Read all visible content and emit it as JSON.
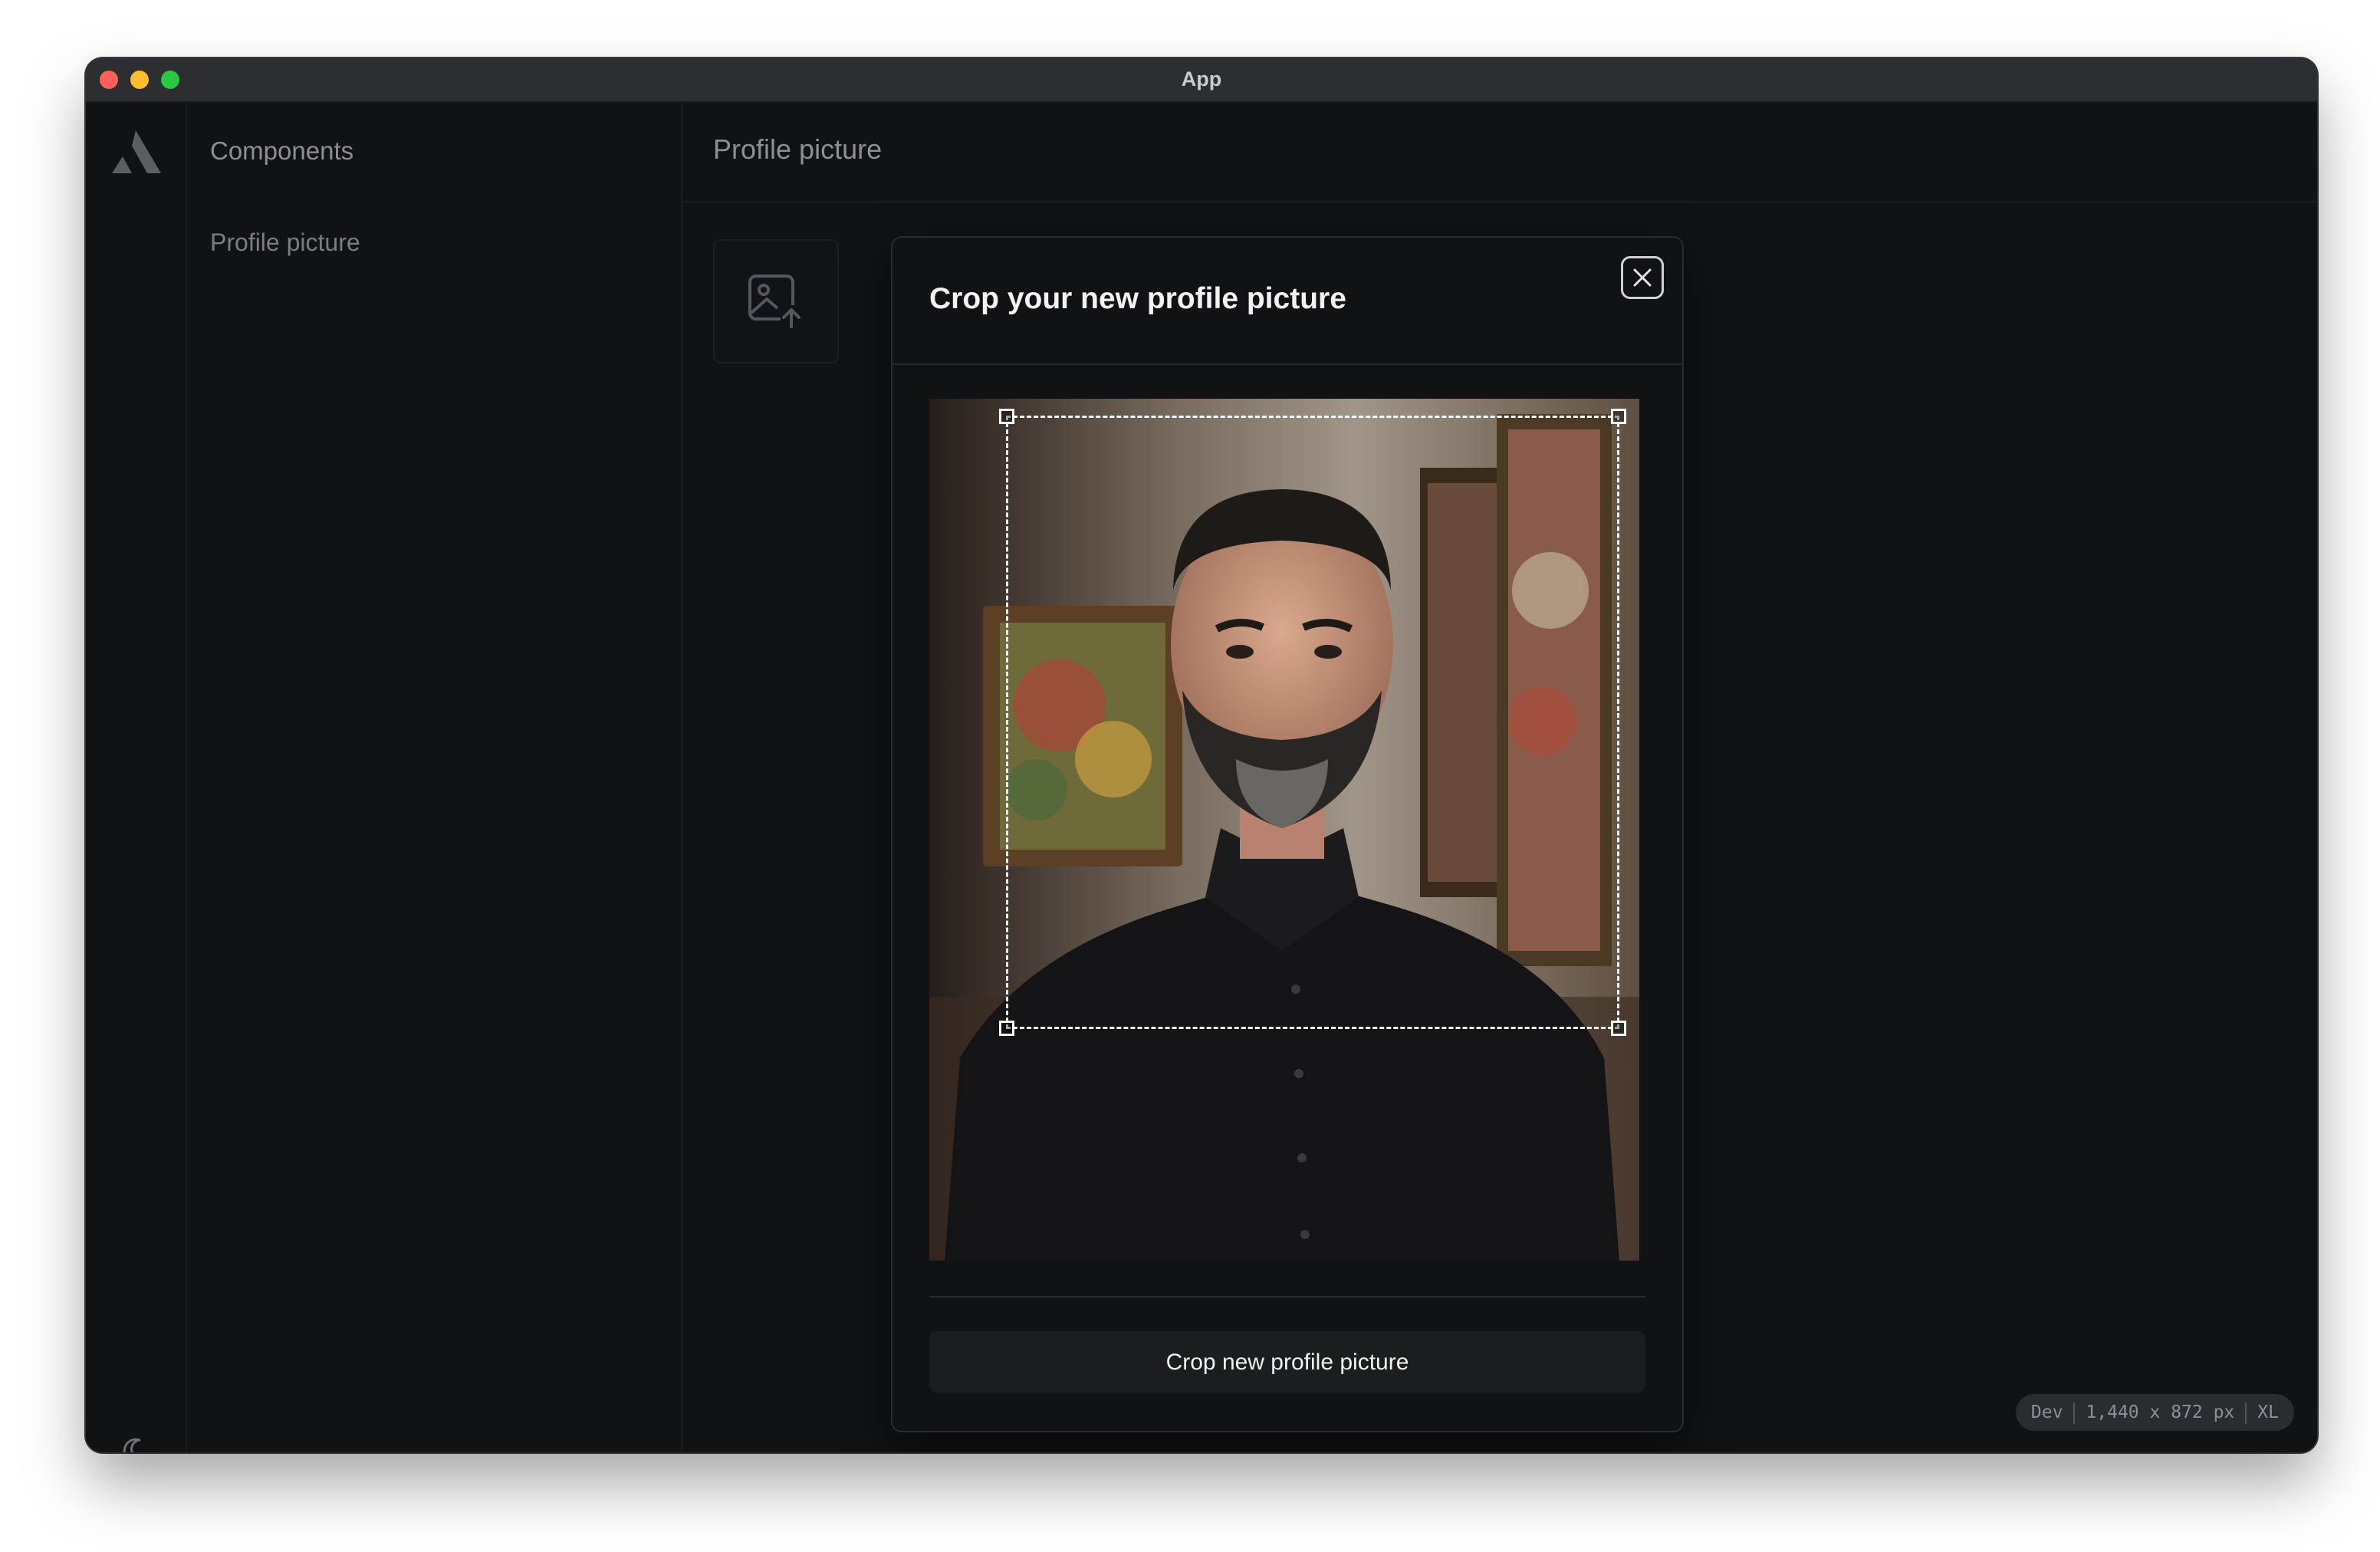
{
  "window": {
    "title": "App",
    "controls": [
      "close",
      "minimize",
      "zoom"
    ]
  },
  "rail": {
    "logo_icon": "triangle-logo-icon",
    "theme_toggle_icon": "moon-icon"
  },
  "sidebar": {
    "heading": "Components",
    "items": [
      {
        "label": "Profile picture"
      }
    ]
  },
  "main": {
    "title": "Profile picture",
    "upload_icon": "image-upload-icon"
  },
  "modal": {
    "title": "Crop your new profile picture",
    "close_icon": "close-icon",
    "crop_button_label": "Crop new profile picture"
  },
  "dev_badge": {
    "env": "Dev",
    "size": "1,440 x 872 px",
    "breakpoint": "XL"
  },
  "colors": {
    "background": "#111214",
    "titlebar": "#2d2e31",
    "text_primary": "#f2f2f4",
    "text_muted": "#8e8f94",
    "accent_white": "#ffffff"
  }
}
